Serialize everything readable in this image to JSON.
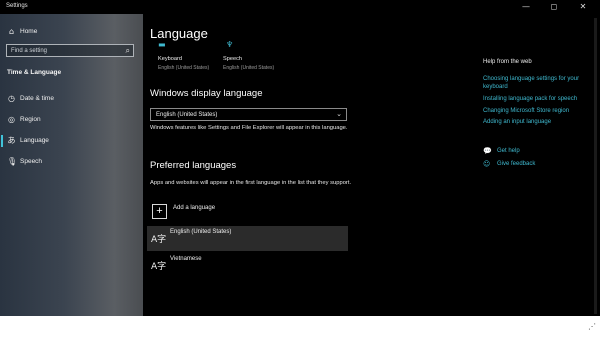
{
  "window": {
    "title": "Settings",
    "controls": {
      "minimize": "—",
      "maximize": "◻",
      "close": "✕"
    }
  },
  "sidebar": {
    "home": "Home",
    "search_placeholder": "Find a setting",
    "section_title": "Time & Language",
    "items": [
      {
        "label": "Date & time",
        "icon": "clock-icon"
      },
      {
        "label": "Region",
        "icon": "globe-icon"
      },
      {
        "label": "Language",
        "icon": "language-icon",
        "active": true
      },
      {
        "label": "Speech",
        "icon": "microphone-icon"
      }
    ]
  },
  "main": {
    "title": "Language",
    "top_items": [
      {
        "label": "Keyboard",
        "sub": "English (United States)",
        "icon": "keyboard-icon"
      },
      {
        "label": "Speech",
        "sub": "English (United States)",
        "icon": "microphone-icon"
      }
    ],
    "display_language": {
      "heading": "Windows display language",
      "selected": "English (United States)",
      "description": "Windows features like Settings and File Explorer will appear in this language."
    },
    "preferred": {
      "heading": "Preferred languages",
      "description": "Apps and websites will appear in the first language in the list that they support.",
      "add_label": "Add a language",
      "languages": [
        "English (United States)",
        "Vietnamese"
      ]
    }
  },
  "right_panel": {
    "heading": "Help from the web",
    "links": [
      "Choosing language settings for your keyboard",
      "Installing language pack for speech",
      "Changing Microsoft Store region",
      "Adding an input language"
    ],
    "get_help": "Get help",
    "give_feedback": "Give feedback"
  },
  "colors": {
    "accent": "#3fb9cf",
    "background": "#000000"
  }
}
